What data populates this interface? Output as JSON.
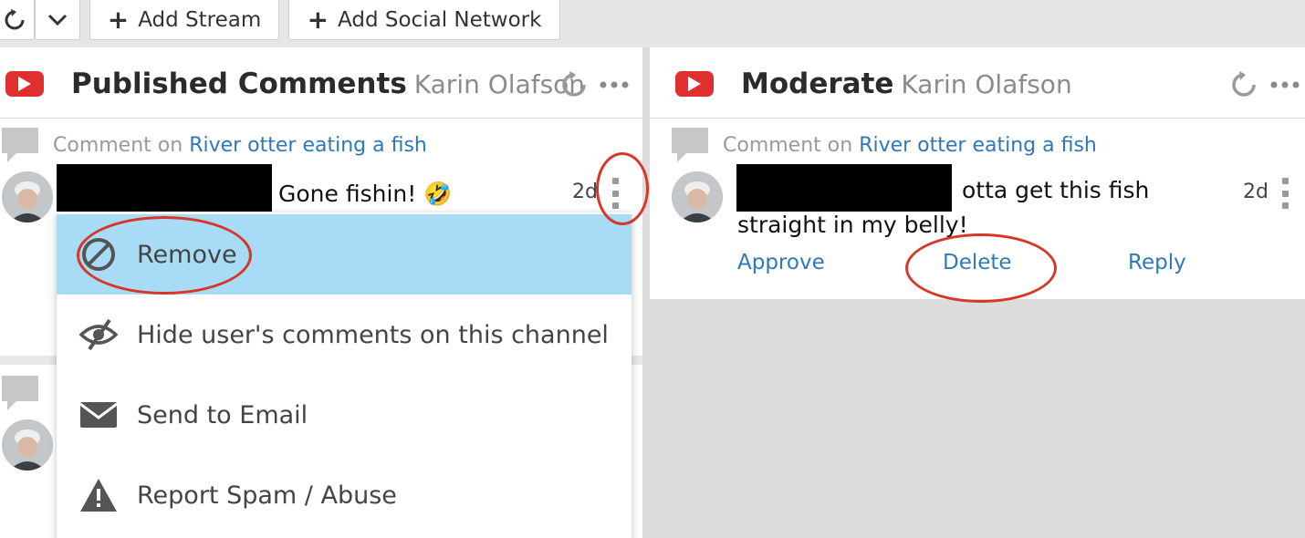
{
  "toolbar": {
    "add_stream_label": "Add Stream",
    "add_social_label": "Add Social Network"
  },
  "columns": [
    {
      "title": "Published Comments",
      "account": "Karin Olafson",
      "comments": [
        {
          "crumb_prefix": "Comment on",
          "crumb_link": "River otter eating a fish",
          "text": "Gone fishin! 🤣",
          "age": "2d"
        }
      ]
    },
    {
      "title": "Moderate",
      "account": "Karin Olafson",
      "comments": [
        {
          "crumb_prefix": "Comment on",
          "crumb_link": "River otter eating a fish",
          "text_line1": "otta get this fish",
          "text_line2": "straight in my belly!",
          "age": "2d",
          "actions": [
            "Approve",
            "Delete",
            "Reply"
          ]
        }
      ]
    }
  ],
  "menu": {
    "items": [
      {
        "label": "Remove",
        "icon": "block-icon",
        "active": true
      },
      {
        "label": "Hide user's comments on this channel",
        "icon": "eye-slash-icon"
      },
      {
        "label": "Send to Email",
        "icon": "envelope-icon"
      },
      {
        "label": "Report Spam / Abuse",
        "icon": "warning-icon"
      }
    ]
  },
  "colors": {
    "youtube_red": "#e02f2f",
    "link_blue": "#2f78b7",
    "menu_highlight": "#a8dcf6",
    "annotation_red": "#d9362a"
  }
}
